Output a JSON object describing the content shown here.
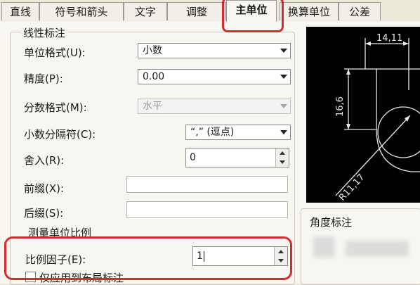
{
  "tabs": [
    {
      "label": "直线"
    },
    {
      "label": "符号和箭头"
    },
    {
      "label": "文字"
    },
    {
      "label": "调整"
    },
    {
      "label": "主单位"
    },
    {
      "label": "换算单位"
    },
    {
      "label": "公差"
    }
  ],
  "active_tab": "主单位",
  "linear": {
    "title": "线性标注",
    "unit_format": {
      "label": "单位格式(U):",
      "value": "小数"
    },
    "precision": {
      "label": "精度(P):",
      "value": "0.00"
    },
    "fraction_format": {
      "label": "分数格式(M):",
      "value": "水平"
    },
    "decimal_separator": {
      "label": "小数分隔符(C):",
      "value": "“,”  (逗点)"
    },
    "round_off": {
      "label": "舍入(R):",
      "value": "0"
    },
    "prefix": {
      "label": "前缀(X):",
      "value": ""
    },
    "suffix": {
      "label": "后缀(S):",
      "value": ""
    },
    "measurement_scale": {
      "title": "测量单位比例",
      "scale_factor": {
        "label": "比例因子(E):",
        "value": "1"
      },
      "apply_layout_label": "仅应用到布局标注"
    }
  },
  "preview": {
    "dim_top": "14,11",
    "dim_left": "16,6",
    "dim_radius": "R11,17"
  },
  "angular": {
    "title": "角度标注"
  },
  "colors": {
    "highlight": "#d42d35",
    "preview_bg": "#000000",
    "preview_lines": "#e8e8e8"
  }
}
